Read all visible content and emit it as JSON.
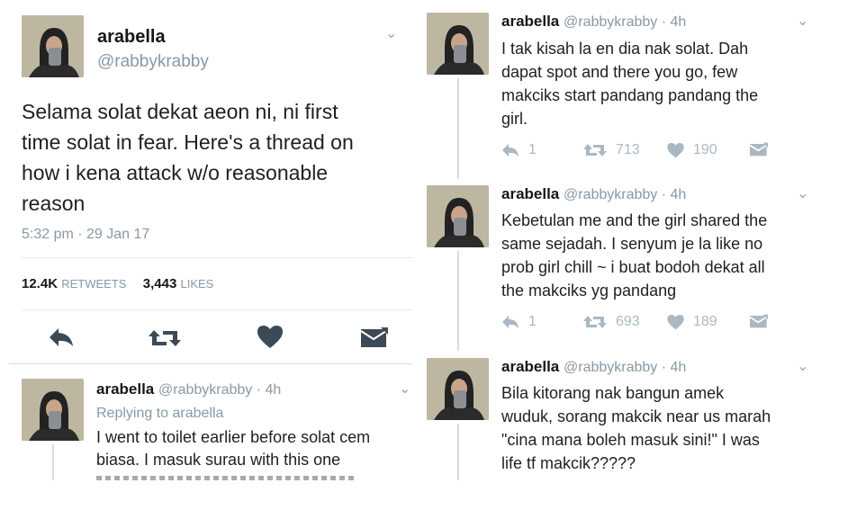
{
  "main_tweet": {
    "name": "arabella",
    "handle": "@rabbykrabby",
    "text_lines": [
      "Selama solat dekat aeon ni, ni first",
      "time solat in fear. Here's a thread on",
      "how i kena attack w/o reasonable",
      "reason"
    ],
    "timestamp": "5:32 pm · 29 Jan 17",
    "retweets_count": "12.4K",
    "retweets_label": "RETWEETS",
    "likes_count": "3,443",
    "likes_label": "LIKES"
  },
  "reply_tweet": {
    "name": "arabella",
    "handle_time": "@rabbykrabby · 4h",
    "replying_to": "Replying to arabella",
    "text_lines": [
      "I went to toilet earlier before solat cem",
      "biasa. I masuk surau with this one"
    ]
  },
  "thread": [
    {
      "name": "arabella",
      "handle_time": "@rabbykrabby · 4h",
      "text_lines": [
        "I tak kisah la en dia nak solat. Dah",
        "dapat spot and there you go, few",
        "makciks start pandang pandang the",
        "girl."
      ],
      "replies": "1",
      "retweets": "713",
      "likes": "190"
    },
    {
      "name": "arabella",
      "handle_time": "@rabbykrabby · 4h",
      "text_lines": [
        "Kebetulan me and the girl shared the",
        "same sejadah. I senyum je la like no",
        "prob girl chill ~ i buat bodoh dekat all",
        "the makciks yg pandang"
      ],
      "replies": "1",
      "retweets": "693",
      "likes": "189"
    },
    {
      "name": "arabella",
      "handle_time": "@rabbykrabby · 4h",
      "text_lines": [
        "Bila kitorang nak bangun amek",
        "wuduk, sorang makcik near us marah",
        "\"cina mana boleh masuk sini!\"  I was",
        "life tf makcik?????"
      ]
    }
  ],
  "icons": {
    "chevron": "chevron-down-icon",
    "reply": "reply-icon",
    "retweet": "retweet-icon",
    "like": "heart-icon",
    "dm": "envelope-icon"
  }
}
